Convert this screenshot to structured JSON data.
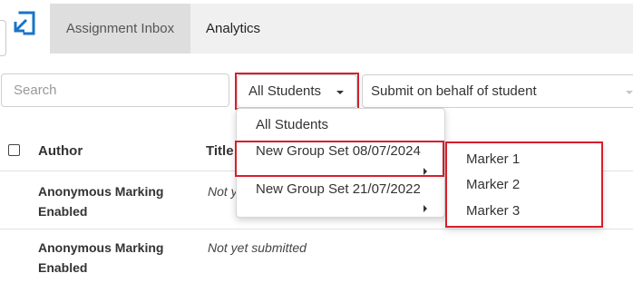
{
  "nav": {
    "logo_icon": "import-arrow-icon",
    "tabs": [
      {
        "label": "Assignment Inbox",
        "active": true
      },
      {
        "label": "Analytics",
        "active": false
      }
    ]
  },
  "filters": {
    "search_placeholder": "Search",
    "student_filter": {
      "selected": "All Students",
      "options": [
        "All Students",
        "New Group Set 08/07/2024",
        "New Group Set 21/07/2022"
      ]
    },
    "submit_behalf": "Submit on behalf of student"
  },
  "submenu": {
    "items": [
      "Marker 1",
      "Marker 2",
      "Marker 3"
    ]
  },
  "table": {
    "columns": [
      "Author",
      "Title"
    ],
    "rows": [
      {
        "author_line1": "Anonymous Marking",
        "author_line2": "Enabled",
        "status": "Not yet submitted"
      },
      {
        "author_line1": "Anonymous Marking",
        "author_line2": "Enabled",
        "status": "Not yet submitted"
      }
    ]
  },
  "colors": {
    "accent": "#1a73c7",
    "highlight": "#d61f2c",
    "nav_bg": "#f0f0f0",
    "active_tab_bg": "#dedede"
  }
}
